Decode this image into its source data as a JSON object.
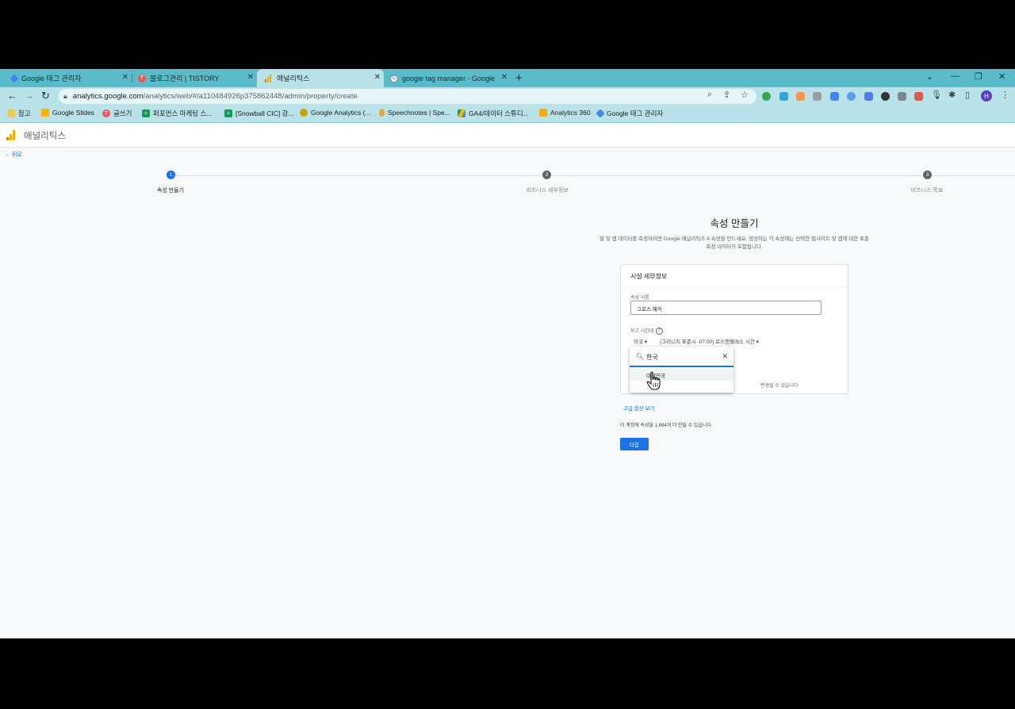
{
  "browser": {
    "tabs": [
      {
        "title": "Google 태그 관리자",
        "active": false
      },
      {
        "title": "블로그관리 | TISTORY",
        "active": false
      },
      {
        "title": "애널리틱스",
        "active": true
      },
      {
        "title": "google tag manager - Google",
        "active": false
      }
    ],
    "new_tab_label": "+",
    "url_host": "analytics.google.com",
    "url_path": "/analytics/web/#/a110484926p375862448/admin/property/create",
    "profile_initial": "H"
  },
  "bookmarks": [
    {
      "label": "참고",
      "icon": "folder-icon",
      "color": "#f2c94c"
    },
    {
      "label": "Google Slides",
      "icon": "slides-icon",
      "color": "#f4b400"
    },
    {
      "label": "글쓰기",
      "icon": "tistory-icon",
      "color": "#eb5757"
    },
    {
      "label": "퍼포먼스 마케팅 스...",
      "icon": "sheet-plus-icon",
      "color": "#0f9d58"
    },
    {
      "label": "[Snowball CIC] 강...",
      "icon": "sheet-plus-icon",
      "color": "#0f9d58"
    },
    {
      "label": "Google Analytics (...",
      "icon": "ga-badge-icon",
      "color": "#c9a400"
    },
    {
      "label": "Speechnotes | Spe...",
      "icon": "speechnotes-icon",
      "color": "#e8a33d"
    },
    {
      "label": "GA4/데이터 스튜디...",
      "icon": "drive-icon",
      "color": "#4285f4"
    },
    {
      "label": "Analytics 360",
      "icon": "analytics-icon",
      "color": "#f9ab00"
    },
    {
      "label": "Google 태그 관리자",
      "icon": "gtm-icon",
      "color": "#4285f4"
    }
  ],
  "app": {
    "title": "애널리틱스",
    "back_label": "뒤로"
  },
  "stepper": {
    "steps": [
      {
        "number": "1",
        "label": "속성 만들기",
        "active": true
      },
      {
        "number": "2",
        "label": "비즈니스 세부정보",
        "active": false
      },
      {
        "number": "3",
        "label": "비즈니스 목표",
        "active": false
      }
    ]
  },
  "main": {
    "heading": "속성 만들기",
    "description_line1": "웹 및 앱 데이터를 측정하려면 Google 애널리틱스 4 속성을 만드세요. 생성하는 각 속성에는 선택한 웹사이트 및 앱에 대한 표준",
    "description_line2": "측정 데이터가 포함됩니다.",
    "card_title": "시설 세부정보",
    "property_name_label": "속성 이름",
    "property_name_value": "그로스 해커",
    "timezone_label": "보고 시간대",
    "country_value": "미국",
    "timezone_value": "(그리니치 표준시 -07:00) 로스앤젤레스 시간",
    "card_note": "변경될 수 있습니다",
    "advanced_link": "고급 옵션 보기",
    "quota_text": "이 계정에 속성을 1,994개 더 만들 수 있습니다.",
    "next_button": "다음"
  },
  "dropdown": {
    "search_value": "한국",
    "options": [
      "대한민국"
    ]
  },
  "colors": {
    "chrome_frame": "#5bbcc9",
    "chrome_toolbar": "#b9e3e9",
    "accent": "#1a73e8",
    "step_inactive": "#5f6368"
  }
}
